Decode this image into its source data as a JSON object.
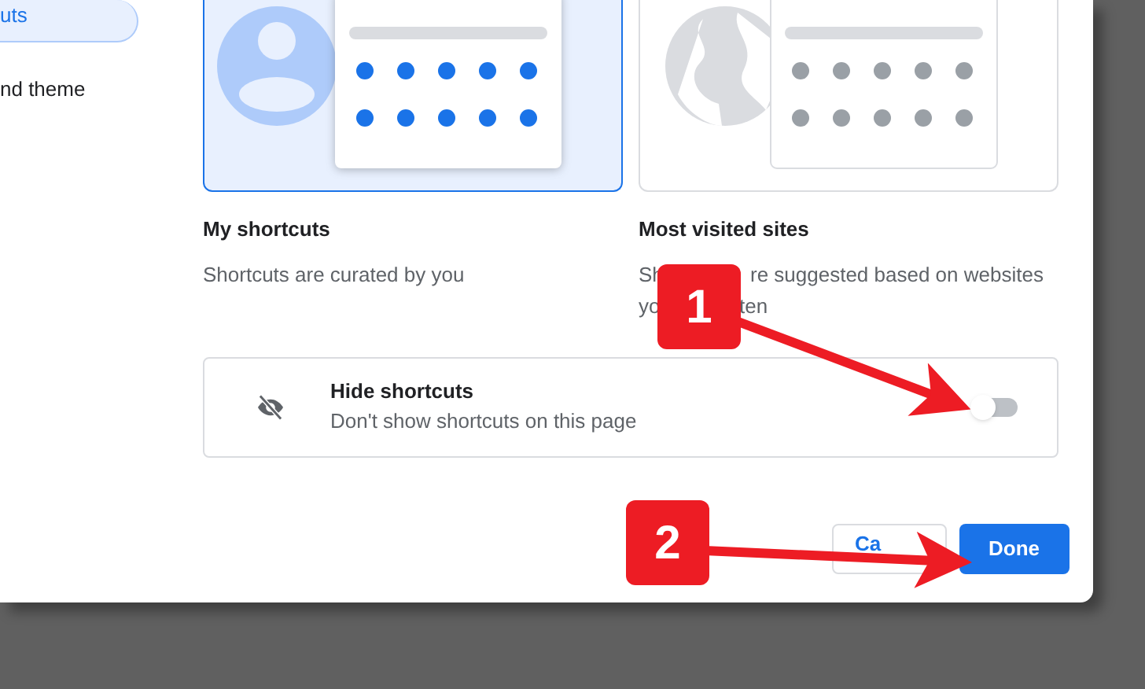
{
  "sidebar": {
    "items": [
      {
        "label": "uts",
        "selected": true
      },
      {
        "label": "nd theme",
        "selected": false
      }
    ]
  },
  "options": [
    {
      "kind": "shortcuts",
      "title": "My shortcuts",
      "description_lines": [
        [
          "Shortcuts are curated by you"
        ]
      ],
      "selected": true
    },
    {
      "kind": "most_visited",
      "title": "Most visited sites",
      "description_lines": [
        [
          "Sh",
          "re suggested based on websites"
        ],
        [
          "yo",
          "ten"
        ]
      ],
      "selected": false
    }
  ],
  "hide_shortcuts": {
    "title": "Hide shortcuts",
    "description": "Don't show shortcuts on this page",
    "on": false
  },
  "buttons": [
    {
      "label": "Ca",
      "kind": "secondary"
    },
    {
      "label": "Done",
      "kind": "primary"
    }
  ],
  "annotations": [
    {
      "number": "1"
    },
    {
      "number": "2"
    }
  ]
}
